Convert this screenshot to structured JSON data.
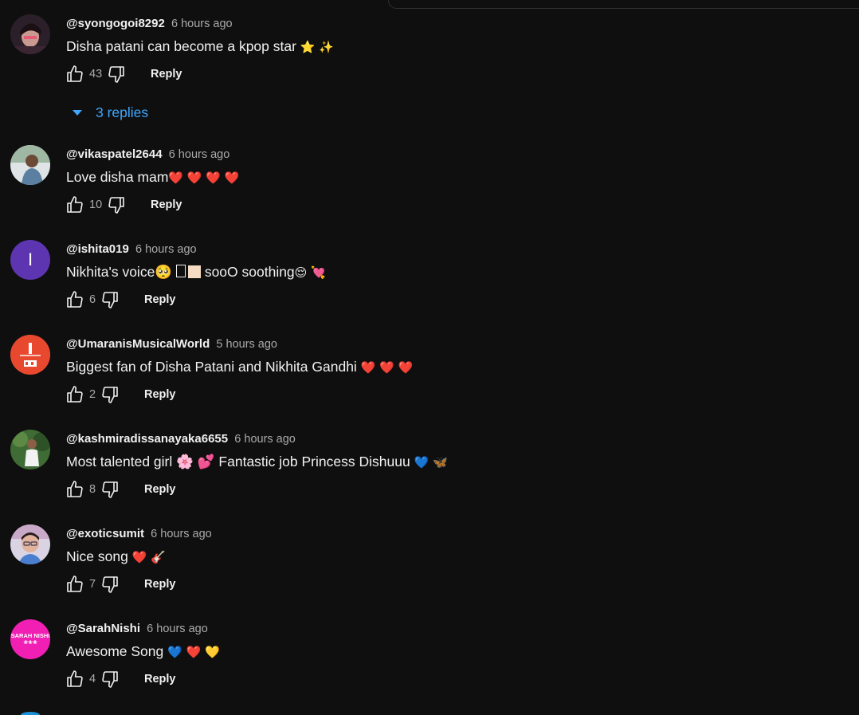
{
  "comments": [
    {
      "author": "@syongogoi8292",
      "time": "6 hours ago",
      "text": "Disha patani can become a kpop star",
      "emojis": "⭐ ✨",
      "likes": "43",
      "reply_label": "Reply",
      "replies_label": "3 replies",
      "avatar_style": "photo-dark"
    },
    {
      "author": "@vikaspatel2644",
      "time": "6 hours ago",
      "text": "Love disha mam",
      "emojis": "❤️ ❤️ ❤️ ❤️",
      "likes": "10",
      "reply_label": "Reply",
      "avatar_style": "photo-outdoor"
    },
    {
      "author": "@ishita019",
      "time": "6 hours ago",
      "text": "Nikhita's voice🥺 ",
      "text_after": " sooO soothing",
      "emojis": "😌 💘",
      "likes": "6",
      "reply_label": "Reply",
      "avatar_letter": "I",
      "avatar_color": "#5e35b1"
    },
    {
      "author": "@UmaranisMusicalWorld",
      "time": "5 hours ago",
      "text": "Biggest fan of Disha Patani and Nikhita Gandhi",
      "emojis": "❤️ ❤️ ❤️",
      "likes": "2",
      "reply_label": "Reply",
      "avatar_color": "#e8492e"
    },
    {
      "author": "@kashmiradissanayaka6655",
      "time": "6 hours ago",
      "text": "Most talented girl 🌸 💕 Fantastic job Princess Dishuuu",
      "emojis": "💙 🦋",
      "likes": "8",
      "reply_label": "Reply",
      "avatar_style": "photo-green"
    },
    {
      "author": "@exoticsumit",
      "time": "6 hours ago",
      "text": "Nice song",
      "emojis": "❤️ 🎸",
      "likes": "7",
      "reply_label": "Reply",
      "avatar_style": "photo-light"
    },
    {
      "author": "@SarahNishi",
      "time": "6 hours ago",
      "text": "Awesome Song",
      "emojis": "💙 ❤️ 💛",
      "likes": "4",
      "reply_label": "Reply",
      "avatar_text": "SARAH NISHI",
      "avatar_subtext": "❀❀❀",
      "avatar_color": "#f21fb4"
    }
  ],
  "colors": {
    "background": "#0f0f0f",
    "text": "#f1f1f1",
    "muted": "#aaaaaa",
    "link": "#3ea6ff"
  }
}
